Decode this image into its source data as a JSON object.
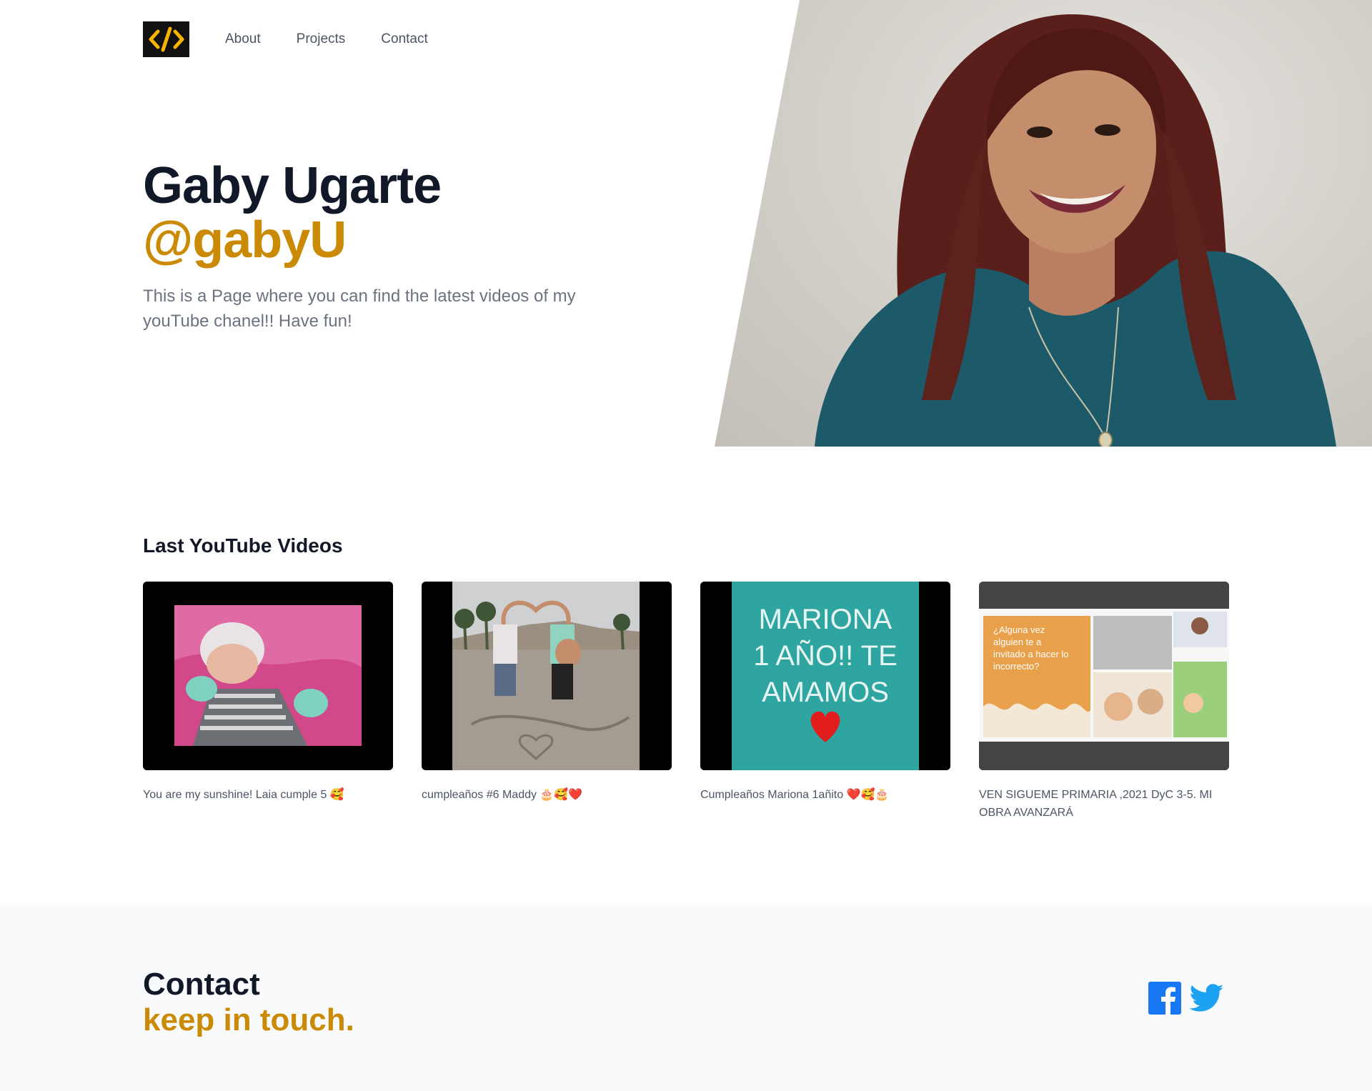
{
  "nav": {
    "logo_icon": "code-brackets-icon",
    "links": [
      "About",
      "Projects",
      "Contact"
    ]
  },
  "hero": {
    "name": "Gaby Ugarte",
    "handle": "@gabyU",
    "description": "This is a Page where you can find the latest videos of my youTube chanel!! Have fun!"
  },
  "videos": {
    "heading": "Last YouTube Videos",
    "items": [
      {
        "title": "You are my sunshine! Laia cumple 5 🥰"
      },
      {
        "title": "cumpleaños #6 Maddy 🎂🥰❤️"
      },
      {
        "title": "Cumpleaños Mariona 1añito ❤️🥰🎂",
        "thumb_text": [
          "MARIONA",
          "1 AÑO!! TE",
          "AMAMOS"
        ]
      },
      {
        "title": "VEN SIGUEME PRIMARIA ,2021 DyC 3-5. MI OBRA AVANZARÁ",
        "thumb_text": [
          "¿Alguna vez",
          "alguien te a",
          "invitado a hacer lo",
          "incorrecto?"
        ]
      }
    ]
  },
  "contact": {
    "title": "Contact",
    "subtitle": "keep in touch.",
    "socials": [
      "facebook-icon",
      "twitter-icon"
    ]
  },
  "colors": {
    "accent": "#ca8a04",
    "dark": "#111827",
    "muted": "#6b7280",
    "facebook": "#1877f2",
    "twitter": "#1da1f2"
  }
}
